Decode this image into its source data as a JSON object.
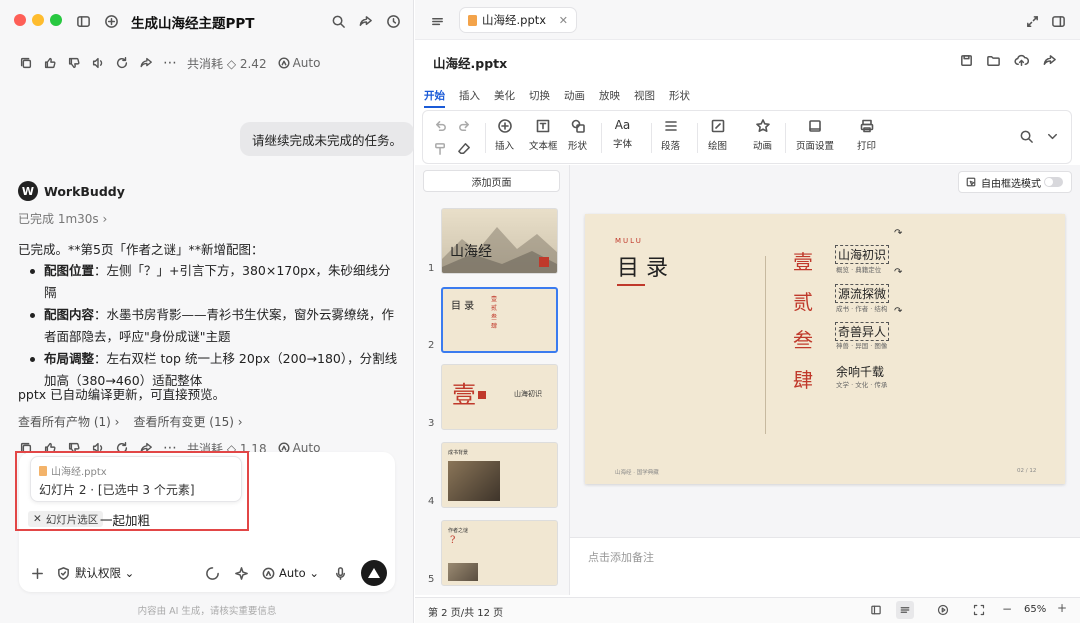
{
  "app": {
    "window_title": "生成山海经主题PPT",
    "colors": {
      "accent": "#1a5ad7",
      "traffic_red": "#fe5f57",
      "traffic_yellow": "#febc2e",
      "traffic_green": "#28c840",
      "highlight": "#e24646"
    }
  },
  "chat": {
    "cost_top": "共消耗 ◇ 2.42",
    "mode_top": "Auto",
    "user_message": "请继续完成未完成的任务。",
    "assistant_name": "WorkBuddy",
    "done_label": "已完成 1m30s",
    "intro": "已完成。**第5页「作者之谜」**新增配图：",
    "bullets": [
      {
        "label": "配图位置",
        "text": "：左侧「？」+引言下方，380×170px，朱砂细线分隔"
      },
      {
        "label": "配图内容",
        "text": "：水墨书房背影——青衫书生伏案，窗外云雾缭绕，作者面部隐去，呼应\"身份成谜\"主题"
      },
      {
        "label": "布局调整",
        "text": "：左右双栏 top 统一上移 20px（200→180），分割线加高（380→460）适配整体"
      }
    ],
    "outro": "pptx 已自动编译更新，可直接预览。",
    "link_artifacts": "查看所有产物 (1)",
    "link_changes": "查看所有变更 (15)",
    "cost_bottom": "共消耗 ◇ 1.18",
    "mode_bottom": "Auto"
  },
  "composer": {
    "ref_file": "山海经.pptx",
    "ref_desc": "幻灯片 2 · [已选中 3 个元素]",
    "chip_label": "幻灯片选区",
    "typed_text": "一起加粗",
    "permission_label": "默认权限",
    "model_label": "Auto",
    "footnote": "内容由 AI 生成，请核实重要信息"
  },
  "editor": {
    "tab_name": "山海经.pptx",
    "doc_title": "山海经.pptx",
    "menu": [
      "开始",
      "插入",
      "美化",
      "切换",
      "动画",
      "放映",
      "视图",
      "形状"
    ],
    "tools": [
      "插入",
      "文本框",
      "形状",
      "字体",
      "段落",
      "绘图",
      "动画",
      "页面设置",
      "打印"
    ],
    "add_page": "添加页面",
    "free_select": "自由框选模式",
    "notes_placeholder": "点击添加备注",
    "page_info": "第 2 页/共 12 页",
    "zoom": "65%",
    "thumb_numbers": [
      "1",
      "2",
      "3",
      "4",
      "5"
    ],
    "thumb_texts": {
      "t1_title": "山海经",
      "t2_title": "目 录",
      "t2_nums": [
        "壹",
        "贰",
        "叁",
        "肆"
      ],
      "t3_char": "壹",
      "t3_title": "山海初识",
      "t4_title": "成书背景",
      "t5_title": "作者之谜",
      "t5_mark": "?"
    }
  },
  "slide": {
    "kicker": "MULU",
    "title": "目  录",
    "items": [
      {
        "num": "壹",
        "title": "山海初识",
        "sub": "概览 · 典籍定位"
      },
      {
        "num": "贰",
        "title": "源流探微",
        "sub": "成书 · 作者 · 结构"
      },
      {
        "num": "叁",
        "title": "奇兽异人",
        "sub": "神兽 · 异国 · 图像"
      },
      {
        "num": "肆",
        "title": "余响千载",
        "sub": "文学 · 文化 · 传承"
      }
    ],
    "footer_left": "山海经 · 国学典藏",
    "footer_right": "02 / 12"
  }
}
